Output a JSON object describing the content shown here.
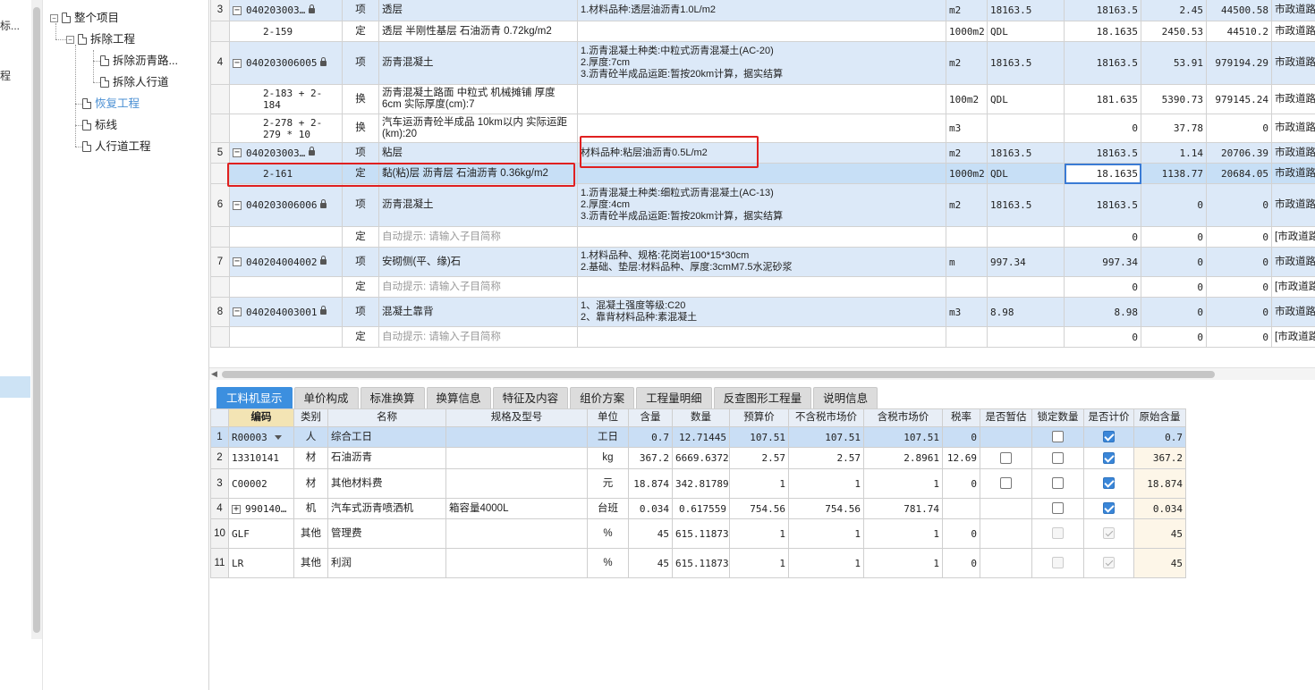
{
  "left_strip": {
    "item1": "标...",
    "item2": "程"
  },
  "tree": {
    "root": "整个项目",
    "n1": "拆除工程",
    "n1a": "拆除沥青路...",
    "n1b": "拆除人行道",
    "n2": "恢复工程",
    "n3": "标线",
    "n4": "人行道工程"
  },
  "upper_rows": [
    {
      "no": "3",
      "code": "040203003…",
      "type": "项",
      "name": "透层",
      "desc": "1.材料品种:透层油沥青1.0L/m2",
      "unit": "m2",
      "expr": "18163.5",
      "qty": "18163.5",
      "price": "2.45",
      "total": "44500.58",
      "major": "市政道路"
    },
    {
      "no": "",
      "code": "2-159",
      "type": "定",
      "name": "透层 半刚性基层 石油沥青 0.72kg/m2",
      "desc": "",
      "unit": "1000m2",
      "expr": "QDL",
      "qty": "18.1635",
      "price": "2450.53",
      "total": "44510.2",
      "major": "市政道路"
    },
    {
      "no": "4",
      "code": "040203006005",
      "type": "项",
      "name": "沥青混凝土",
      "desc": "1.沥青混凝土种类:中粒式沥青混凝土(AC-20)\n2.厚度:7cm\n3.沥青砼半成品运距:暂按20km计算，据实结算",
      "unit": "m2",
      "expr": "18163.5",
      "qty": "18163.5",
      "price": "53.91",
      "total": "979194.29",
      "major": "市政道路"
    },
    {
      "no": "",
      "code": "2-183 + 2-184",
      "type": "换",
      "name": "沥青混凝土路面 中粒式 机械摊铺 厚度6cm  实际厚度(cm):7",
      "desc": "",
      "unit": "100m2",
      "expr": "QDL",
      "qty": "181.635",
      "price": "5390.73",
      "total": "979145.24",
      "major": "市政道路"
    },
    {
      "no": "",
      "code": "2-278 + 2-279 * 10",
      "type": "换",
      "name": "汽车运沥青砼半成品 10km以内  实际运距(km):20",
      "desc": "",
      "unit": "m3",
      "expr": "",
      "qty": "0",
      "price": "37.78",
      "total": "0",
      "major": "市政道路"
    },
    {
      "no": "5",
      "code": "040203003…",
      "type": "项",
      "name": "粘层",
      "desc": "材料品种:粘层油沥青0.5L/m2",
      "unit": "m2",
      "expr": "18163.5",
      "qty": "18163.5",
      "price": "1.14",
      "total": "20706.39",
      "major": "市政道路"
    },
    {
      "no": "",
      "code": "2-161",
      "type": "定",
      "name": "黏(粘)层 沥青层 石油沥青 0.36kg/m2",
      "desc": "",
      "unit": "1000m2",
      "expr": "QDL",
      "qty": "18.1635",
      "price": "1138.77",
      "total": "20684.05",
      "major": "市政道路"
    },
    {
      "no": "6",
      "code": "040203006006",
      "type": "项",
      "name": "沥青混凝土",
      "desc": "1.沥青混凝土种类:细粒式沥青混凝土(AC-13)\n2.厚度:4cm\n3.沥青砼半成品运距:暂按20km计算，据实结算",
      "unit": "m2",
      "expr": "18163.5",
      "qty": "18163.5",
      "price": "0",
      "total": "0",
      "major": "市政道路"
    },
    {
      "no": "",
      "code": "",
      "type": "定",
      "name": "自动提示: 请输入子目简称",
      "desc": "",
      "unit": "",
      "expr": "",
      "qty": "0",
      "price": "0",
      "total": "0",
      "major": "[市政道路"
    },
    {
      "no": "7",
      "code": "040204004002",
      "type": "项",
      "name": "安砌侧(平、缘)石",
      "desc": "1.材料品种、规格:花岗岩100*15*30cm\n2.基础、垫层:材料品种、厚度:3cmM7.5水泥砂浆",
      "unit": "m",
      "expr": "997.34",
      "qty": "997.34",
      "price": "0",
      "total": "0",
      "major": "市政道路"
    },
    {
      "no": "",
      "code": "",
      "type": "定",
      "name": "自动提示: 请输入子目简称",
      "desc": "",
      "unit": "",
      "expr": "",
      "qty": "0",
      "price": "0",
      "total": "0",
      "major": "[市政道路"
    },
    {
      "no": "8",
      "code": "040204003001",
      "type": "项",
      "name": "混凝土靠背",
      "desc": "1、混凝土强度等级:C20\n2、靠背材料品种:素混凝土",
      "unit": "m3",
      "expr": "8.98",
      "qty": "8.98",
      "price": "0",
      "total": "0",
      "major": "市政道路"
    },
    {
      "no": "",
      "code": "",
      "type": "定",
      "name": "自动提示: 请输入子目简称",
      "desc": "",
      "unit": "",
      "expr": "",
      "qty": "0",
      "price": "0",
      "total": "0",
      "major": "[市政道路"
    }
  ],
  "tabs": [
    "工料机显示",
    "单价构成",
    "标准换算",
    "换算信息",
    "特征及内容",
    "组价方案",
    "工程量明细",
    "反查图形工程量",
    "说明信息"
  ],
  "lower_headers": [
    "",
    "编码",
    "类别",
    "名称",
    "规格及型号",
    "单位",
    "含量",
    "数量",
    "预算价",
    "不含税市场价",
    "含税市场价",
    "税率",
    "是否暂估",
    "锁定数量",
    "是否计价",
    "原始含量"
  ],
  "lower_rows": [
    {
      "rn": "1",
      "code": "R00003",
      "cat": "人",
      "name": "综合工日",
      "spec": "",
      "unit": "工日",
      "content": "0.7",
      "qty": "12.71445",
      "budget": "107.51",
      "mkt_ex": "107.51",
      "mkt_in": "107.51",
      "tax": "0",
      "orig": "0.7"
    },
    {
      "rn": "2",
      "code": "13310141",
      "cat": "材",
      "name": "石油沥青",
      "spec": "",
      "unit": "kg",
      "content": "367.2",
      "qty": "6669.6372",
      "budget": "2.57",
      "mkt_ex": "2.57",
      "mkt_in": "2.8961",
      "tax": "12.69",
      "orig": "367.2"
    },
    {
      "rn": "3",
      "code": "C00002",
      "cat": "材",
      "name": "其他材料费",
      "spec": "",
      "unit": "元",
      "content": "18.874",
      "qty": "342.817899",
      "budget": "1",
      "mkt_ex": "1",
      "mkt_in": "1",
      "tax": "0",
      "orig": "18.874"
    },
    {
      "rn": "4",
      "code": "990140…",
      "cat": "机",
      "name": "汽车式沥青喷洒机",
      "spec": "箱容量4000L",
      "unit": "台班",
      "content": "0.034",
      "qty": "0.617559",
      "budget": "754.56",
      "mkt_ex": "754.56",
      "mkt_in": "781.74",
      "tax": "",
      "orig": "0.034"
    },
    {
      "rn": "10",
      "code": "GLF",
      "cat": "其他",
      "name": "管理费",
      "spec": "",
      "unit": "%",
      "content": "45",
      "qty": "615.118734",
      "budget": "1",
      "mkt_ex": "1",
      "mkt_in": "1",
      "tax": "0",
      "orig": "45"
    },
    {
      "rn": "11",
      "code": "LR",
      "cat": "其他",
      "name": "利润",
      "spec": "",
      "unit": "%",
      "content": "45",
      "qty": "615.118734",
      "budget": "1",
      "mkt_ex": "1",
      "mkt_in": "1",
      "tax": "0",
      "orig": "45"
    }
  ],
  "colors": {
    "tab_active": "#3c8fdf",
    "row_item": "#dce9f8",
    "row_selected": "#c7dff6",
    "annotation": "#e02020"
  }
}
